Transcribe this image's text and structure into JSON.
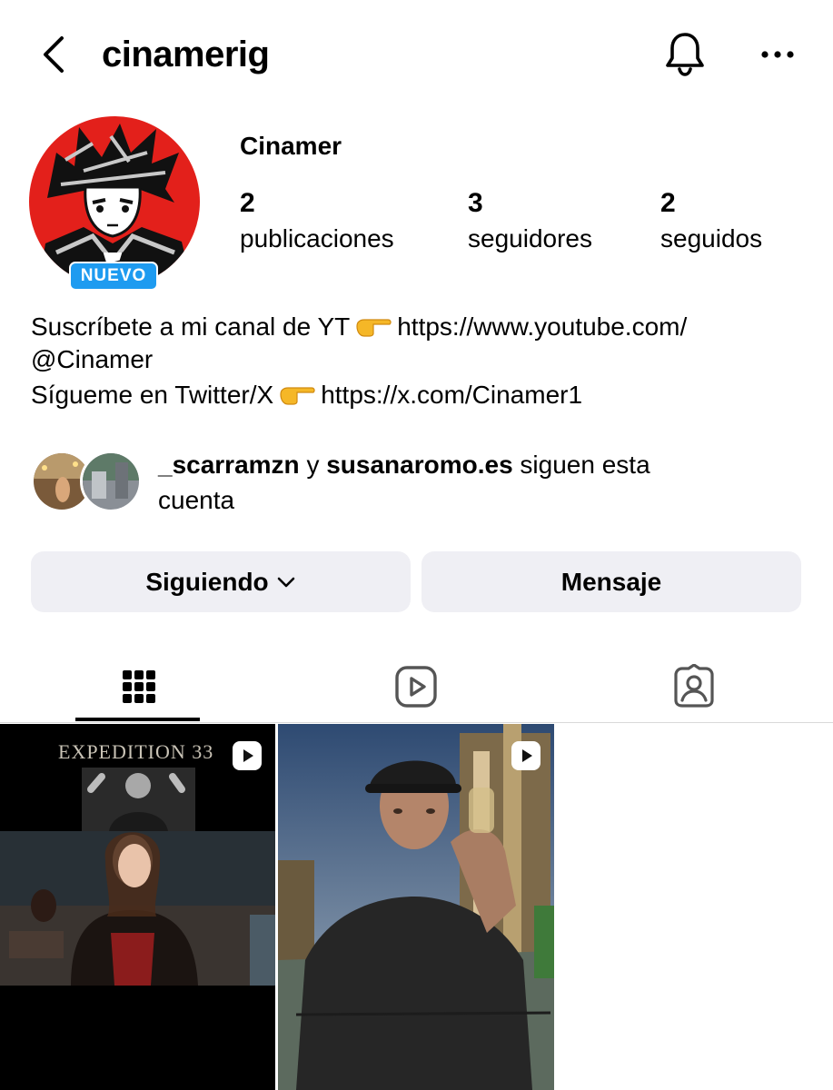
{
  "header": {
    "username": "cinamerig",
    "back_icon": "chevron-left-icon",
    "notification_icon": "bell-icon",
    "more_icon": "more-horizontal-icon"
  },
  "profile": {
    "display_name": "Cinamer",
    "new_badge": "NUEVO",
    "stats": [
      {
        "value": "2",
        "label": "publicaciones"
      },
      {
        "value": "3",
        "label": "seguidores"
      },
      {
        "value": "2",
        "label": "seguidos"
      }
    ],
    "bio": {
      "line1_text": "Suscríbete a mi canal de YT",
      "line1_link": "https://www.youtube.com/",
      "line2": "@Cinamer",
      "line3_text": "Sígueme en Twitter/X",
      "line3_link": "https://x.com/Cinamer1"
    }
  },
  "followed_by": {
    "user1": "_scarramzn",
    "conjunction": "y",
    "user2": "susanaromo.es",
    "suffix_line1": "siguen esta",
    "suffix_line2": "cuenta"
  },
  "actions": {
    "following_label": "Siguiendo",
    "message_label": "Mensaje"
  },
  "tabs": [
    {
      "icon": "grid-icon",
      "active": true
    },
    {
      "icon": "reels-icon",
      "active": false
    },
    {
      "icon": "tagged-icon",
      "active": false
    }
  ],
  "posts": [
    {
      "overlay_title": "EXPEDITION 33",
      "type": "reel"
    },
    {
      "type": "reel"
    }
  ],
  "colors": {
    "badge": "#1e9bf0",
    "button_bg": "#efeff4",
    "avatar_bg": "#e3201b"
  }
}
